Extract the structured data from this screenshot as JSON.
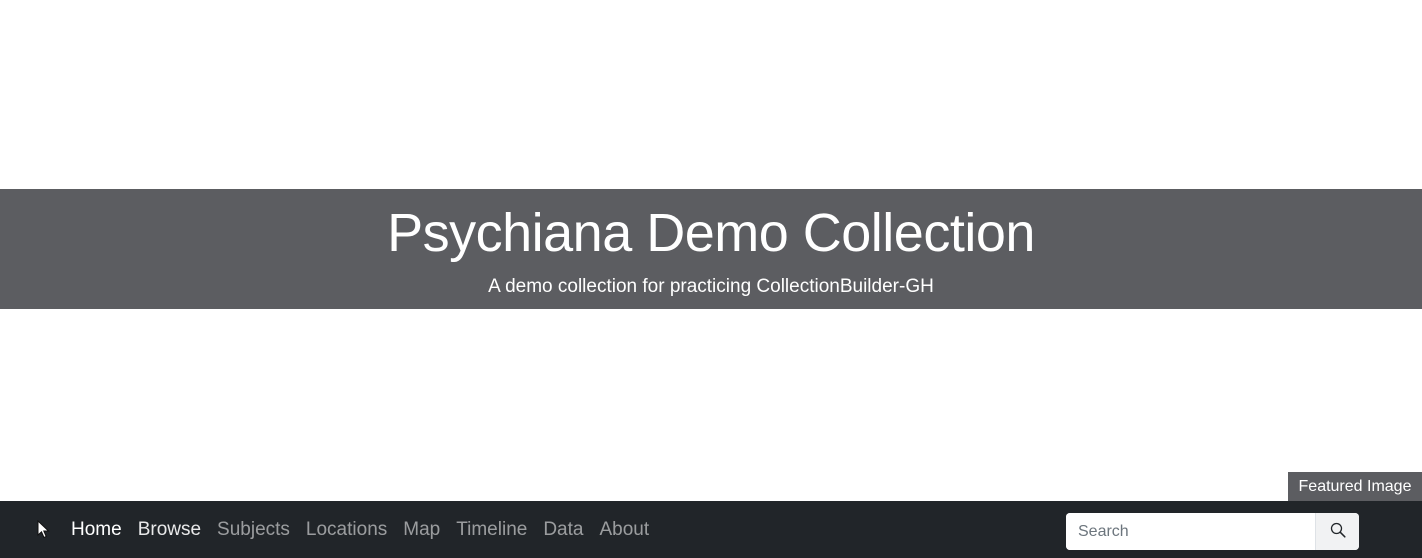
{
  "header": {
    "title": "Psychiana Demo Collection",
    "subtitle": "A demo collection for practicing CollectionBuilder-GH"
  },
  "featured": {
    "label": "Featured Image"
  },
  "navbar": {
    "brand_icon": "cursor-arrow-icon",
    "items": [
      {
        "label": "Home",
        "state": "active"
      },
      {
        "label": "Browse",
        "state": "highlighted"
      },
      {
        "label": "Subjects",
        "state": "normal"
      },
      {
        "label": "Locations",
        "state": "normal"
      },
      {
        "label": "Map",
        "state": "normal"
      },
      {
        "label": "Timeline",
        "state": "normal"
      },
      {
        "label": "Data",
        "state": "normal"
      },
      {
        "label": "About",
        "state": "normal"
      }
    ],
    "search": {
      "placeholder": "Search",
      "value": "",
      "button_icon": "search-icon"
    }
  },
  "colors": {
    "banner": "#5c5d61",
    "navbar": "#212529",
    "text_light": "#ffffff"
  }
}
